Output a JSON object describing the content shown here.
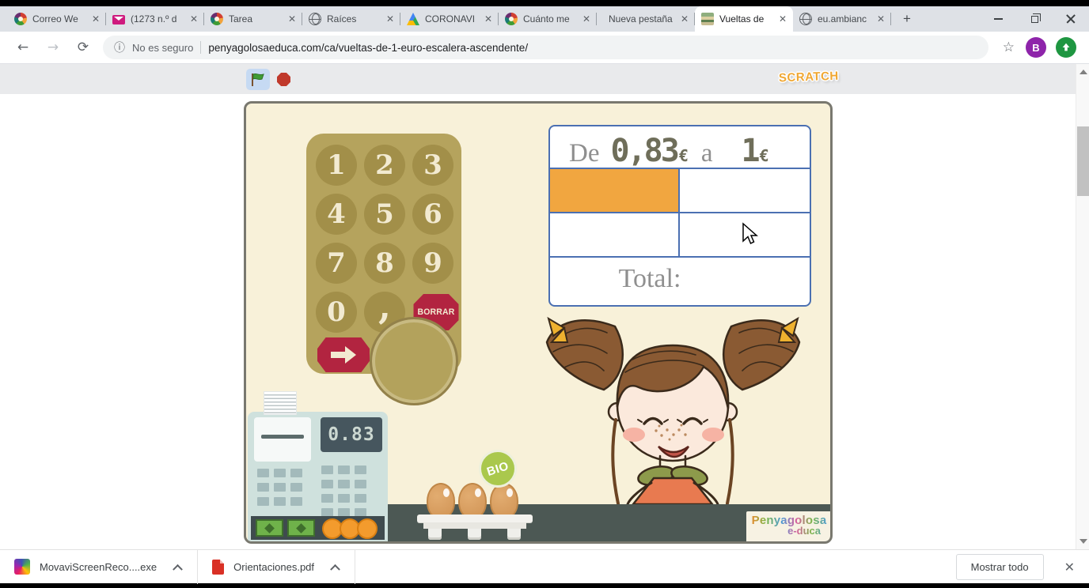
{
  "colors": {
    "accent_blue": "#4b70b2",
    "cell_orange": "#f1a640",
    "stage_cream": "#f8f1d9",
    "keypad_tan": "#b5a35d",
    "button_red": "#b22440",
    "counter_gray": "#4c5854",
    "register_teal": "#cfe1dd",
    "scratch_gold": "#f0a732",
    "avatar_purple": "#8e24aa"
  },
  "icons": {
    "close": "✕",
    "star": "☆",
    "plus": "+",
    "back": "←",
    "forward": "→",
    "reload": "⟳",
    "info": "ⓘ"
  },
  "browser": {
    "tabs": [
      {
        "label": "Correo We",
        "icon": "colorwheel-icon"
      },
      {
        "label": "(1273 n.º d",
        "icon": "mail-icon"
      },
      {
        "label": "Tarea",
        "icon": "colorwheel-icon"
      },
      {
        "label": "Raíces",
        "icon": "globe-icon"
      },
      {
        "label": "CORONAVI",
        "icon": "drive-icon"
      },
      {
        "label": "Cuánto me",
        "icon": "colorwheel-icon"
      },
      {
        "label": "Nueva pestaña",
        "icon": "none"
      },
      {
        "label": "Vueltas de",
        "icon": "image-icon"
      },
      {
        "label": "eu.ambianc",
        "icon": "globe-icon"
      }
    ],
    "toolbar": {
      "security_label": "No es seguro",
      "url": "penyagolosaeduca.com/ca/vueltas-de-1-euro-escalera-ascendente/",
      "avatar_letter": "B"
    }
  },
  "page": {
    "scratch_logo": "SCRATCH",
    "problem": {
      "prefix": "De",
      "from_amount": "0,83",
      "currency": "€",
      "connector": "a",
      "to_amount": "1",
      "total_label": "Total:"
    },
    "keypad": {
      "digits": [
        "1",
        "2",
        "3",
        "4",
        "5",
        "6",
        "7",
        "8",
        "9"
      ],
      "zero": "0",
      "comma": ",",
      "delete_label": "BORRAR"
    },
    "register_display": "0.83",
    "bio_label": "BIO",
    "brand": {
      "line1": "Penyagolosa",
      "line2": "e-duca"
    }
  },
  "downloads": {
    "items": [
      {
        "filename": "MovaviScreenReco....exe"
      },
      {
        "filename": "Orientaciones.pdf"
      }
    ],
    "show_all_label": "Mostrar todo"
  }
}
